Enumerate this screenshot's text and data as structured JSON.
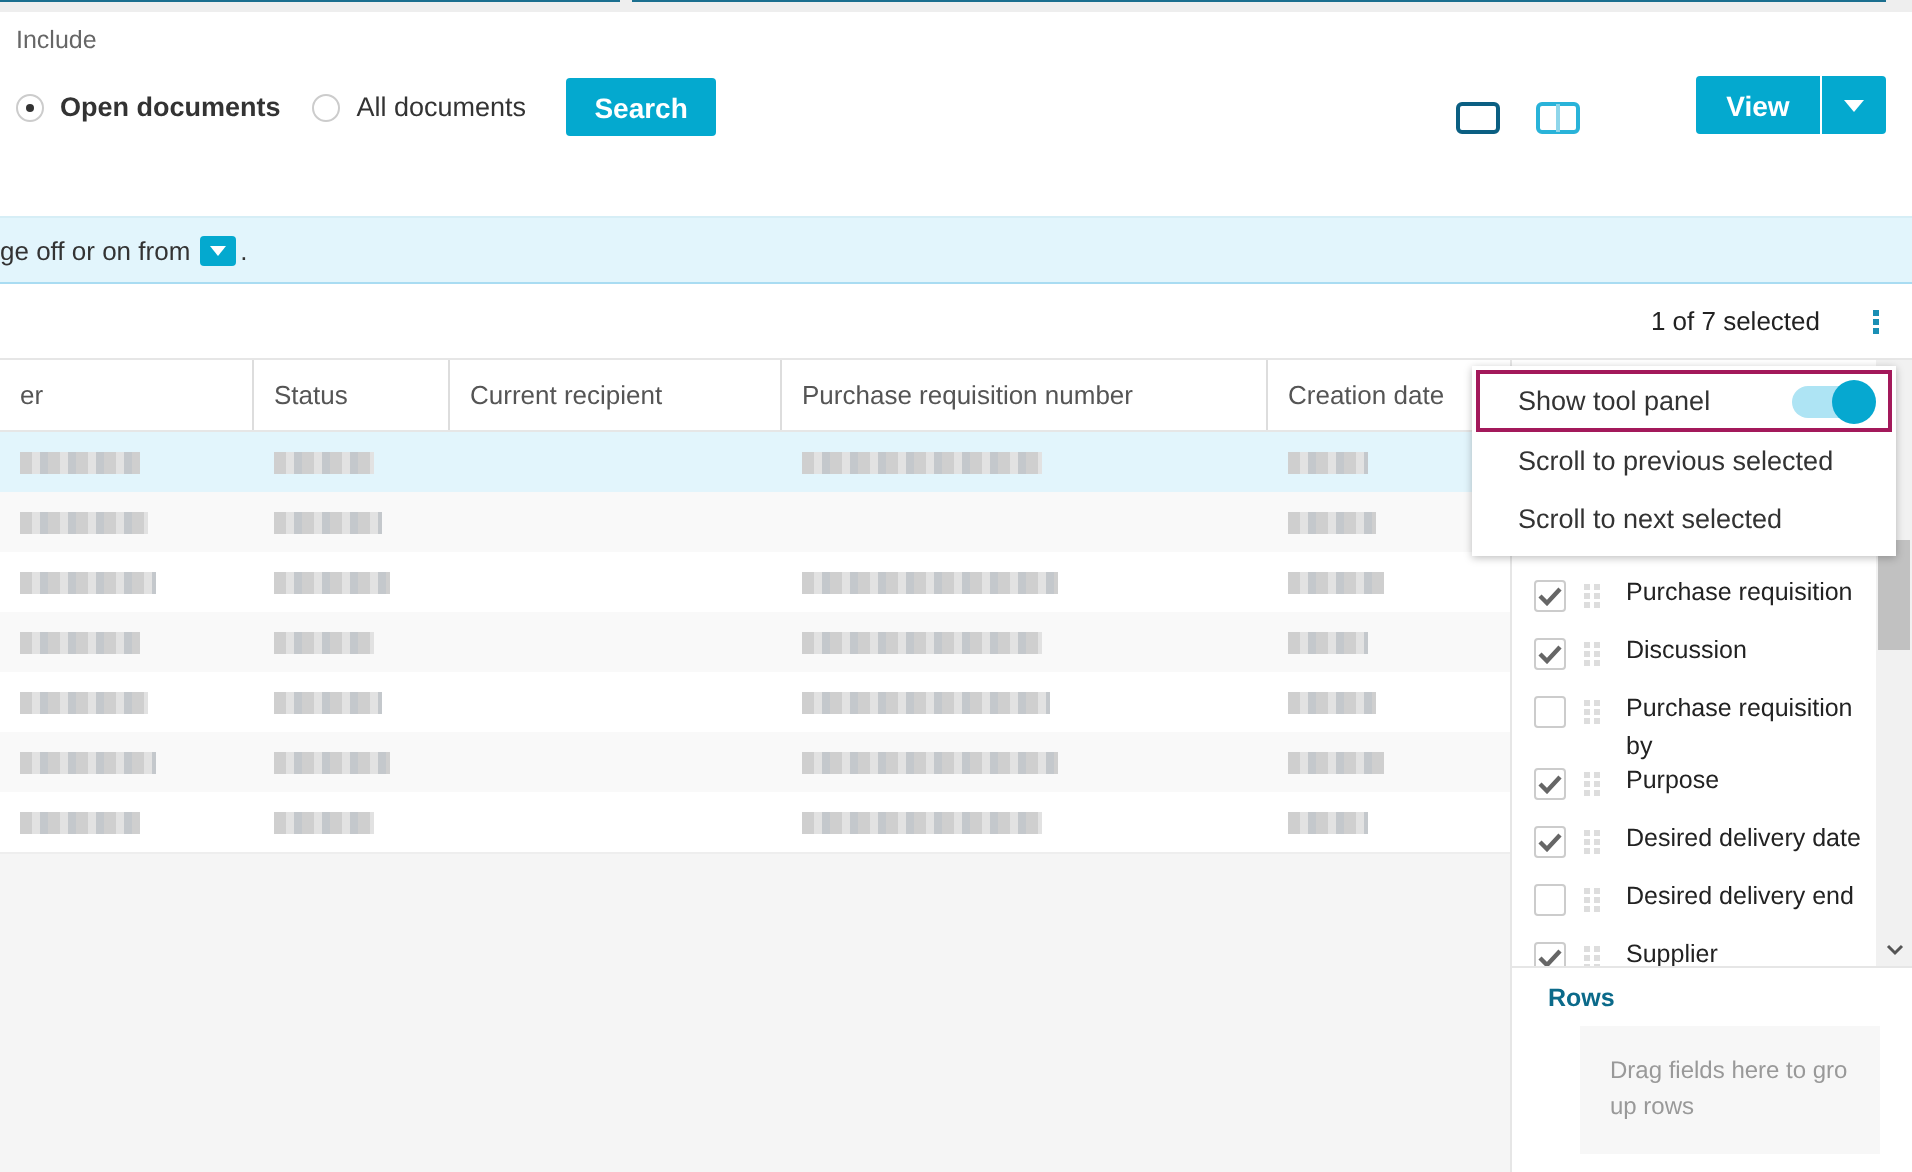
{
  "filter": {
    "label": "Include",
    "options": [
      {
        "label": "Open documents",
        "selected": true
      },
      {
        "label": "All documents",
        "selected": false
      }
    ],
    "search_button": "Search"
  },
  "layout_buttons": [
    {
      "kind": "single",
      "selected": true
    },
    {
      "kind": "split",
      "selected": false
    }
  ],
  "view_button": "View",
  "info_bar": {
    "text": "ge off or on from",
    "suffix": "."
  },
  "selection_count": "1 of 7 selected",
  "table": {
    "columns": [
      "er",
      "Status",
      "Current recipient",
      "Purchase requisition number",
      "Creation date"
    ],
    "rows": [
      {
        "selected": true,
        "blurred_cells": [
          true,
          true,
          false,
          true,
          true
        ]
      },
      {
        "selected": false,
        "blurred_cells": [
          true,
          true,
          false,
          false,
          true
        ]
      },
      {
        "selected": false,
        "blurred_cells": [
          true,
          true,
          false,
          true,
          true
        ]
      },
      {
        "selected": false,
        "blurred_cells": [
          true,
          true,
          false,
          true,
          true
        ]
      },
      {
        "selected": false,
        "blurred_cells": [
          true,
          true,
          false,
          true,
          true
        ]
      },
      {
        "selected": false,
        "blurred_cells": [
          true,
          true,
          false,
          true,
          true
        ]
      },
      {
        "selected": false,
        "blurred_cells": [
          true,
          true,
          false,
          true,
          true
        ]
      }
    ]
  },
  "context_menu": {
    "items": [
      {
        "kind": "toggle",
        "label": "Show tool panel",
        "on": true,
        "focused": true
      },
      {
        "kind": "action",
        "label": "Scroll to previous selected",
        "focused": false
      },
      {
        "kind": "action",
        "label": "Scroll to next selected",
        "focused": false
      }
    ]
  },
  "tool_panel": {
    "columns": [
      {
        "label": "Purchase requisition",
        "checked": true
      },
      {
        "label": "Discussion",
        "checked": true
      },
      {
        "label": "Purchase requisition by",
        "checked": false
      },
      {
        "label": "Purpose",
        "checked": true
      },
      {
        "label": "Desired delivery date",
        "checked": true
      },
      {
        "label": "Desired delivery end",
        "checked": false
      },
      {
        "label": "Supplier",
        "checked": true
      }
    ],
    "rows_heading": "Rows",
    "rows_drop_hint": "Drag fields here to group rows"
  }
}
